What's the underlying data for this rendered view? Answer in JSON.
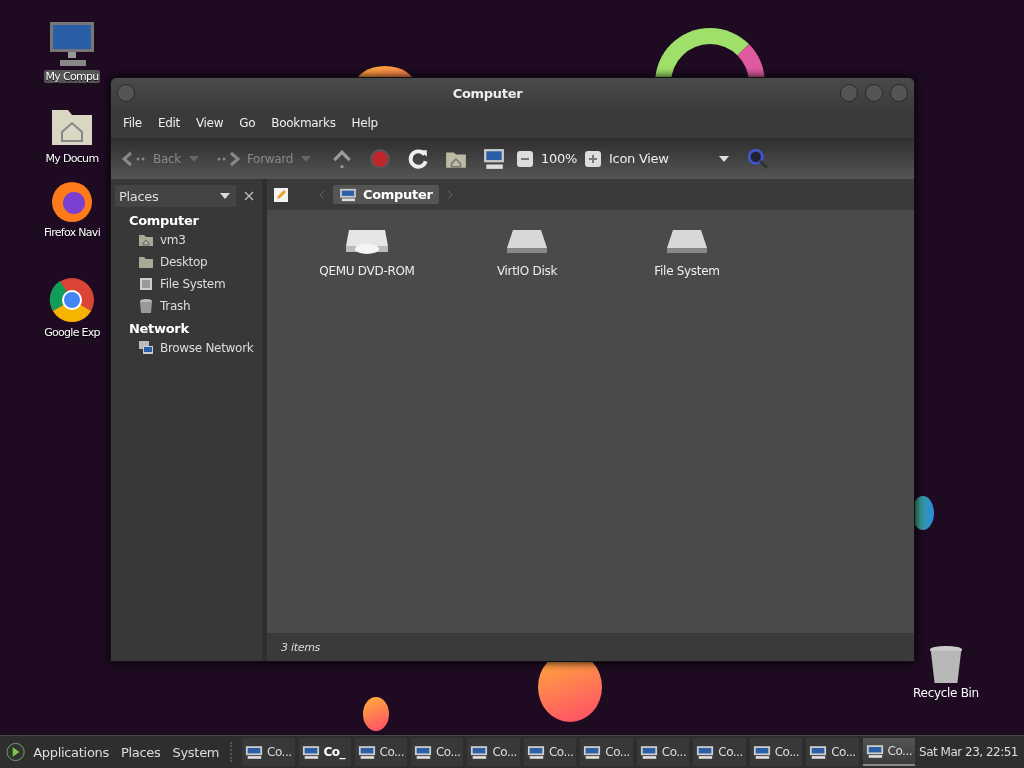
{
  "desktop_icons": [
    {
      "label": "My Compu",
      "kind": "computer",
      "selected": true
    },
    {
      "label": "My Docum",
      "kind": "home-folder",
      "selected": false
    },
    {
      "label": "Firefox Navi",
      "kind": "firefox",
      "selected": false
    },
    {
      "label": "Google Exp",
      "kind": "chrome",
      "selected": false
    }
  ],
  "recycle_bin": {
    "label": "Recycle Bin"
  },
  "window": {
    "title": "Computer",
    "menu": [
      "File",
      "Edit",
      "View",
      "Go",
      "Bookmarks",
      "Help"
    ],
    "toolbar": {
      "back": "Back",
      "forward": "Forward",
      "zoom": "100%",
      "view_mode": "Icon View"
    },
    "sidebar": {
      "selector": "Places",
      "sections": [
        {
          "label": "Computer",
          "children": [
            {
              "label": "vm3",
              "kind": "home"
            },
            {
              "label": "Desktop",
              "kind": "folder"
            },
            {
              "label": "File System",
              "kind": "drive"
            },
            {
              "label": "Trash",
              "kind": "trash"
            }
          ]
        },
        {
          "label": "Network",
          "children": [
            {
              "label": "Browse Network",
              "kind": "network"
            }
          ]
        }
      ]
    },
    "path": {
      "crumb": "Computer"
    },
    "items": [
      {
        "label": "QEMU DVD-ROM",
        "kind": "optical"
      },
      {
        "label": "VirtIO Disk",
        "kind": "disk"
      },
      {
        "label": "File System",
        "kind": "disk"
      }
    ],
    "status_bar": "3 items"
  },
  "taskbar": {
    "menus": [
      "Applications",
      "Places",
      "System"
    ],
    "tasks": [
      {
        "label": "Co...",
        "selected": false,
        "bold": false
      },
      {
        "label": "Co_",
        "selected": false,
        "bold": true
      },
      {
        "label": "Co...",
        "selected": false,
        "bold": false
      },
      {
        "label": "Co...",
        "selected": false,
        "bold": false
      },
      {
        "label": "Co...",
        "selected": false,
        "bold": false
      },
      {
        "label": "Co...",
        "selected": false,
        "bold": false
      },
      {
        "label": "Co...",
        "selected": false,
        "bold": false
      },
      {
        "label": "Co...",
        "selected": false,
        "bold": false
      },
      {
        "label": "Co...",
        "selected": false,
        "bold": false
      },
      {
        "label": "Co...",
        "selected": false,
        "bold": false
      },
      {
        "label": "Co...",
        "selected": false,
        "bold": false
      },
      {
        "label": "Co...",
        "selected": true,
        "bold": false
      }
    ],
    "clock": "Sat Mar 23, 22:51"
  }
}
